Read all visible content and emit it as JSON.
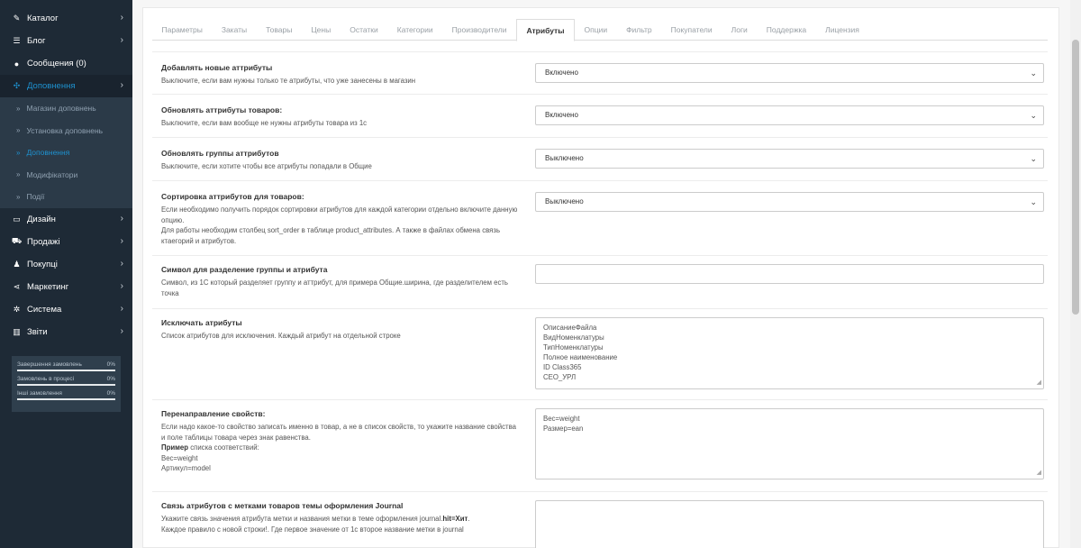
{
  "sidebar": {
    "menu": [
      {
        "icon": "tag-icon",
        "glyph": "✎",
        "label": "Каталог",
        "chevron": true
      },
      {
        "icon": "list-icon",
        "glyph": "☰",
        "label": "Блог",
        "chevron": true
      },
      {
        "icon": "comment-icon",
        "glyph": "●",
        "label": "Сообщения (0)",
        "chevron": false
      },
      {
        "icon": "puzzle-icon",
        "glyph": "✣",
        "label": "Доповнення",
        "chevron": true,
        "active": true
      }
    ],
    "submenu": [
      {
        "label": "Магазин доповнень"
      },
      {
        "label": "Установка доповнень"
      },
      {
        "label": "Доповнення",
        "active": true
      },
      {
        "label": "Модифікатори"
      },
      {
        "label": "Події"
      }
    ],
    "menu2": [
      {
        "icon": "desktop-icon",
        "glyph": "▭",
        "label": "Дизайн"
      },
      {
        "icon": "cart-icon",
        "glyph": "⛟",
        "label": "Продажі"
      },
      {
        "icon": "user-icon",
        "glyph": "♟",
        "label": "Покупці"
      },
      {
        "icon": "share-icon",
        "glyph": "⋖",
        "label": "Маркетинг"
      },
      {
        "icon": "cog-icon",
        "glyph": "✲",
        "label": "Система"
      },
      {
        "icon": "bar-chart-icon",
        "glyph": "▥",
        "label": "Звіти"
      }
    ],
    "stats": [
      {
        "label": "Завершення замовлень",
        "value": "0%"
      },
      {
        "label": "Замовлень в процесі",
        "value": "0%"
      },
      {
        "label": "Інші замовлення",
        "value": "0%"
      }
    ]
  },
  "tabs": [
    "Параметры",
    "Закаты",
    "Товары",
    "Цены",
    "Остатки",
    "Категории",
    "Производители",
    "Атрибуты",
    "Опции",
    "Фильтр",
    "Покупатели",
    "Логи",
    "Поддержка",
    "Лицензия"
  ],
  "active_tab": "Атрибуты",
  "form": {
    "add_attributes": {
      "title": "Добавлять новые аттрибуты",
      "help": "Выключите, если вам нужны только те атрибуты, что уже занесены в магазин",
      "value": "Включено"
    },
    "update_attributes": {
      "title": "Обновлять аттрибуты товаров:",
      "help": "Выключите, если вам вообще не нужны атрибуты товара из 1с",
      "value": "Включено"
    },
    "update_groups": {
      "title": "Обновлять группы аттрибутов",
      "help": "Выключите, если хотите чтобы все атрибуты попадали в Общие",
      "value": "Выключено"
    },
    "sort_attributes": {
      "title": "Сортировка аттрибутов для товаров:",
      "help1": "Если необходимо получить порядок сортировки атрибутов для каждой категории отдельно включите данную опцию.",
      "help2": "Для работы необходим столбец sort_order в таблице product_attributes. А также в файлах обмена связь ктаегорий и атрибутов.",
      "value": "Выключено"
    },
    "separator": {
      "title": "Символ для разделение группы и атрибута",
      "help": "Символ, из 1С который разделяет группу и аттрибут, для примера Общие.ширина, где разделителем есть точка",
      "value": ""
    },
    "exclude": {
      "title": "Исключать атрибуты",
      "help": "Список атрибутов для исключения. Каждый атрибут на отдельной строке",
      "lines": [
        "ОписаниеФайла",
        "ВидНоменклатуры",
        "ТипНоменклатуры",
        "Полное наименование",
        "ID Class365",
        "CEO_УРЛ"
      ]
    },
    "redirect": {
      "title": "Перенаправление свойств:",
      "help": "Если надо какое-то свойство записать именно в товар, а не в список свойств, то укажите название свойства и поле таблицы товара через знак равенства.",
      "example_bold": "Пример",
      "example_rest": " списка соответствий:",
      "ex1": "Вес=weight",
      "ex2": "Артикул=model",
      "lines": [
        "Вес=weight",
        "Размер=ean"
      ]
    },
    "journal": {
      "title": "Связь атрибутов с метками товаров темы оформления Journal",
      "help1_a": "Укажите связь значения атрибута метки и названия метки в теме оформления journal.",
      "help1_b": "hit=Хит",
      "help1_c": ".",
      "help2": "Каждое правило с новой строки!. Где первое значение от 1с второе название метки в journal"
    }
  }
}
